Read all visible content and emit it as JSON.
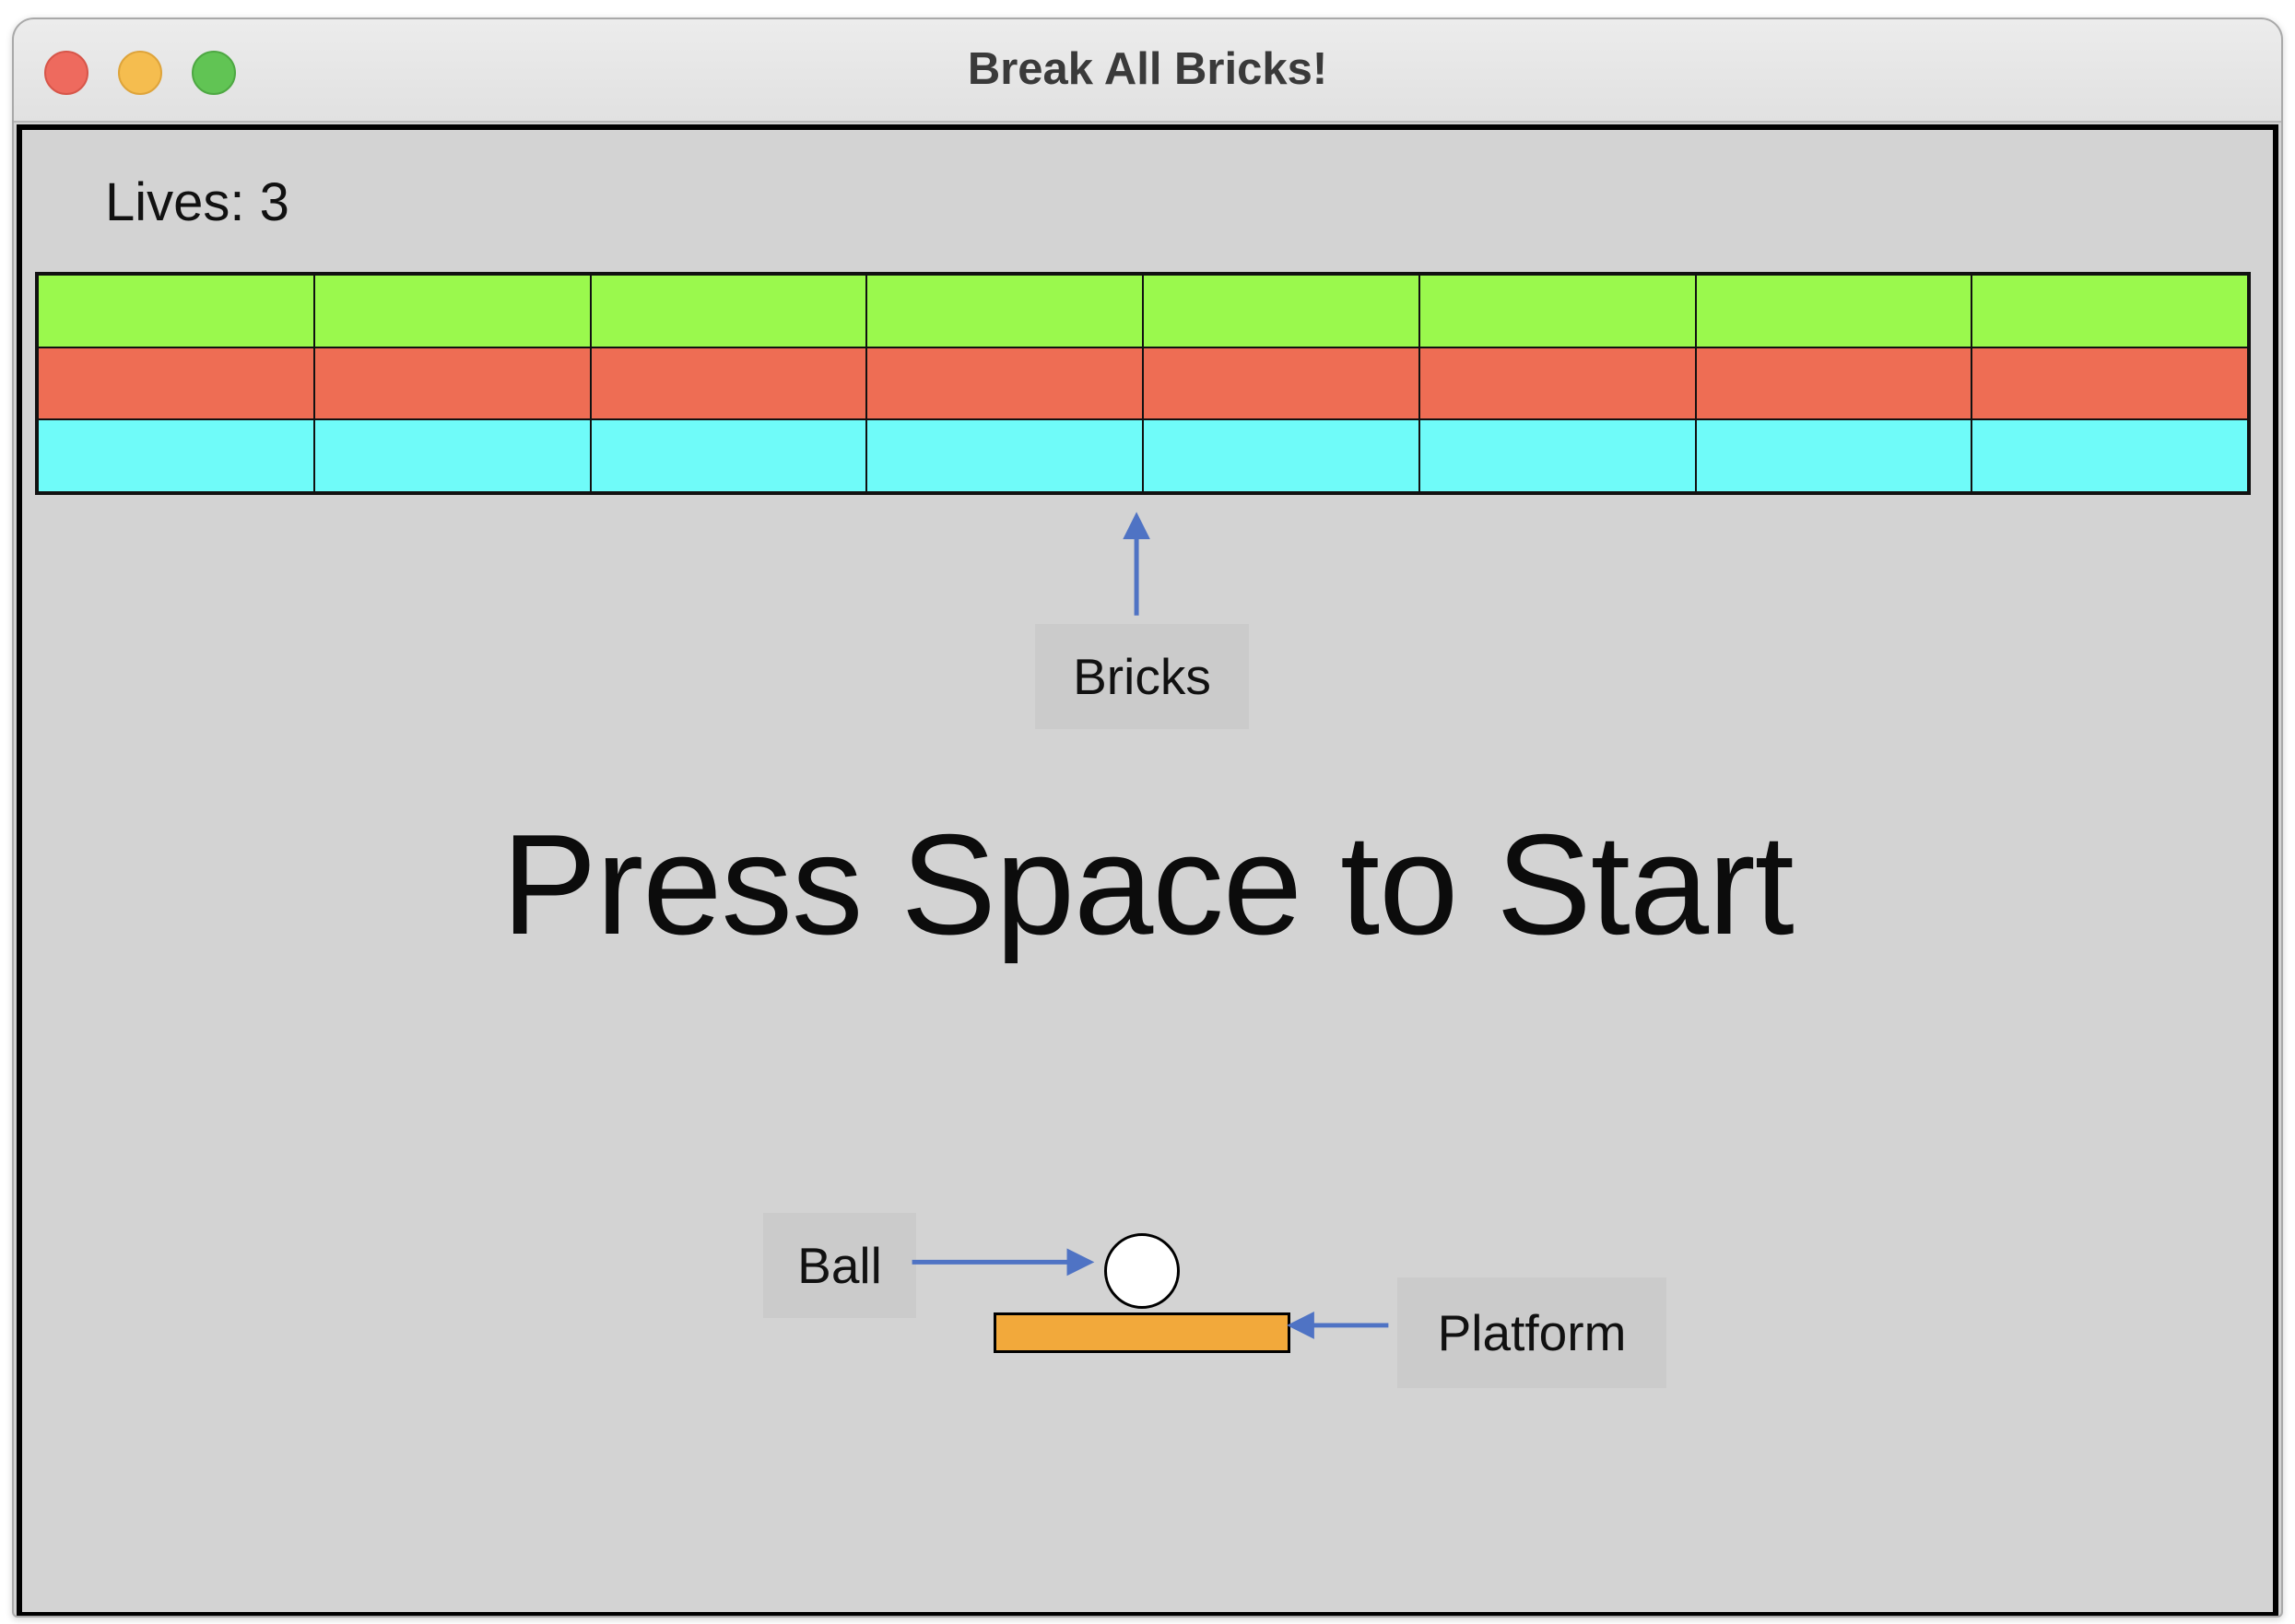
{
  "window": {
    "title": "Break All Bricks!",
    "controls": [
      "close",
      "minimize",
      "maximize"
    ]
  },
  "game": {
    "lives_label": "Lives: 3",
    "lives": 3,
    "message": "Press Space to Start",
    "brick_rows": [
      {
        "color": "#9af94d",
        "count": 8
      },
      {
        "color": "#ee6d54",
        "count": 8
      },
      {
        "color": "#6ffbf9",
        "count": 8
      }
    ]
  },
  "annotations": {
    "bricks": "Bricks",
    "ball": "Ball",
    "platform": "Platform",
    "arrow_color": "#4f73c4"
  }
}
